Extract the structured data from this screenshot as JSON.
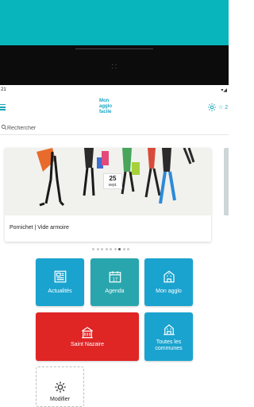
{
  "status_bar": {
    "time": "21",
    "signal": "▾◢"
  },
  "black_bar": {
    "glyph": "⸬"
  },
  "header": {
    "logo_lines": [
      "Mon",
      "agglo",
      "facile"
    ],
    "star_count": "☆ 2"
  },
  "search": {
    "placeholder": "Rechercher",
    "value": ""
  },
  "carousel": {
    "card_title": "Pornichet | Vide armoire",
    "date_day": "25",
    "date_month": "sept.",
    "dots_total": 9,
    "active_dot": 6
  },
  "tiles": {
    "actualites": "Actualités",
    "agenda": "Agenda",
    "mon_agglo": "Mon agglo",
    "saint_nazaire": "Saint Nazaire",
    "toutes_communes_line1": "Toutes les",
    "toutes_communes_line2": "communes",
    "modifier": "Modifier"
  },
  "colors": {
    "teal": "#08b5bd",
    "tile_blue": "#1aa3cf",
    "tile_teal": "#29a6ad",
    "tile_red": "#e02525"
  },
  "icons": [
    "menu-icon",
    "gear-icon",
    "star-icon",
    "search-icon",
    "newspaper-icon",
    "calendar-icon",
    "building-icon",
    "city-hall-icon",
    "town-icon",
    "settings-icon"
  ]
}
